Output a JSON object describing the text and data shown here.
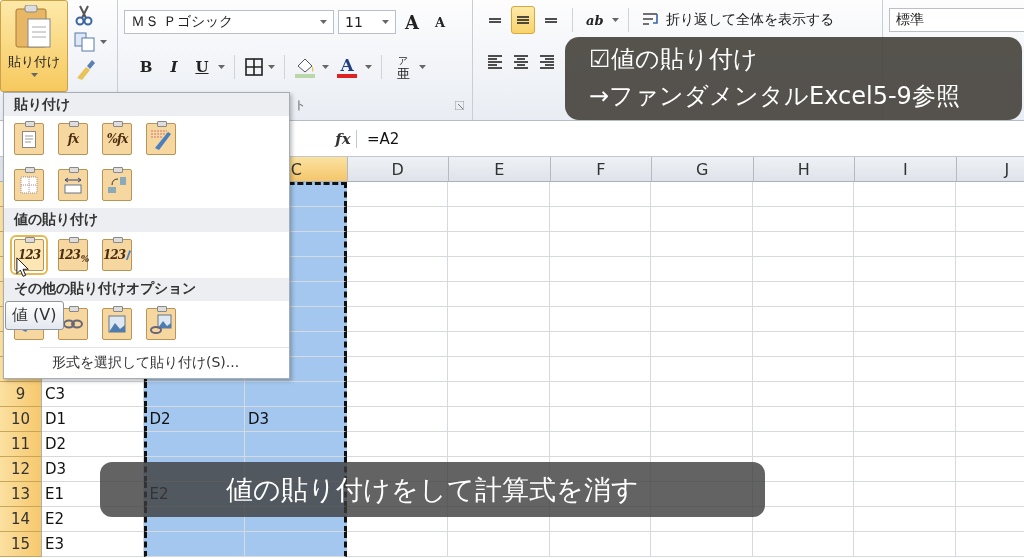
{
  "ribbon": {
    "clipboard": {
      "paste_label": "貼り付け",
      "paste_selected": true
    },
    "font": {
      "name": "ＭＳ Ｐゴシック",
      "size": "11",
      "grow_label": "A",
      "shrink_label": "A",
      "bold": "B",
      "italic": "I",
      "underline": "U",
      "font_color_label": "A",
      "phonetic_label": "亜",
      "phonetic_ruby": "ア",
      "group_label": "ト"
    },
    "alignment": {
      "vertical": [
        {
          "kind": "top",
          "selected": false
        },
        {
          "kind": "middle",
          "selected": true
        },
        {
          "kind": "bottom",
          "selected": false
        }
      ],
      "horizontal": [
        {
          "kind": "left"
        },
        {
          "kind": "center"
        },
        {
          "kind": "right"
        }
      ],
      "orientation_label": "ab",
      "wrap_text": "折り返して全体を表示する"
    },
    "number": {
      "format": "標準"
    }
  },
  "formula_bar": {
    "fx": "fx",
    "formula": "=A2"
  },
  "sheet": {
    "columns": [
      {
        "label": "C",
        "selected": true
      },
      {
        "label": "D",
        "selected": false
      },
      {
        "label": "E",
        "selected": false
      },
      {
        "label": "F",
        "selected": false
      },
      {
        "label": "G",
        "selected": false
      },
      {
        "label": "H",
        "selected": false
      },
      {
        "label": "I",
        "selected": false
      },
      {
        "label": "J",
        "selected": false
      }
    ],
    "rows": [
      {
        "selected": true
      },
      {
        "selected": true
      },
      {
        "selected": true
      },
      {
        "selected": true
      },
      {
        "selected": true
      },
      {
        "selected": true
      },
      {
        "selected": true
      },
      {
        "selected": true
      },
      {
        "number": "9",
        "a": "C3",
        "selected": true
      },
      {
        "number": "10",
        "a": "D1",
        "b": "D2",
        "c": "D3",
        "selected": true
      },
      {
        "number": "11",
        "a": "D2",
        "selected": true
      },
      {
        "number": "12",
        "a": "D3",
        "selected": true
      },
      {
        "number": "13",
        "a": "E1",
        "b": "E2",
        "selected": true
      },
      {
        "number": "14",
        "a": "E2",
        "selected": true
      },
      {
        "number": "15",
        "a": "E3",
        "selected": true
      }
    ]
  },
  "paste_menu": {
    "sections": [
      {
        "title": "貼り付け",
        "rows": [
          [
            {
              "kind": "document",
              "selected": false
            },
            {
              "kind": "formula",
              "glyph": "fx",
              "selected": false
            },
            {
              "kind": "formula",
              "glyph": "%fx",
              "selected": false
            },
            {
              "kind": "keep-source",
              "selected": false
            }
          ],
          [
            {
              "kind": "no-borders",
              "selected": false
            },
            {
              "kind": "column-widths",
              "selected": false
            },
            {
              "kind": "transpose",
              "selected": false
            }
          ]
        ]
      },
      {
        "title": "値の貼り付け",
        "rows": [
          [
            {
              "kind": "values",
              "glyph": "123",
              "selected": true
            },
            {
              "kind": "values",
              "glyph": "123",
              "sub": "%",
              "selected": false
            },
            {
              "kind": "values-source",
              "glyph": "123",
              "selected": false
            }
          ]
        ]
      },
      {
        "title": "その他の貼り付けオプション",
        "rows": [
          [
            {
              "kind": "formatting",
              "selected": false
            },
            {
              "kind": "link",
              "selected": false
            },
            {
              "kind": "picture",
              "selected": false
            },
            {
              "kind": "linked-picture",
              "selected": false
            }
          ]
        ]
      }
    ],
    "footer": "形式を選択して貼り付け(S)..."
  },
  "tooltip": "値 (V)",
  "captions": {
    "note": [
      "☑値の貼り付け",
      "→ファンダメンタルExcel5-9参照"
    ],
    "subtitle": "値の貼り付けをして計算式を消す"
  }
}
